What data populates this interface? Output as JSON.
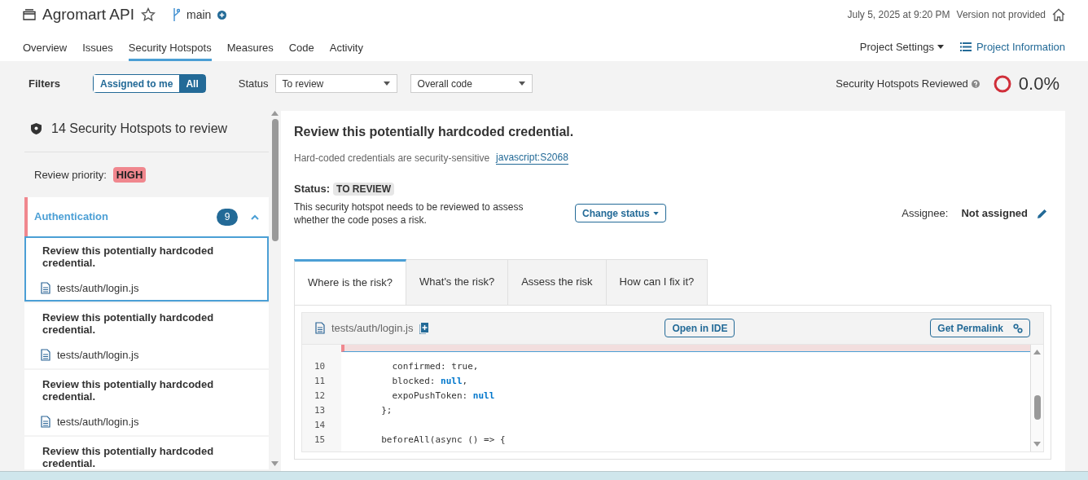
{
  "project": {
    "name": "Agromart API",
    "branch": "main",
    "date": "July 5, 2025 at 9:20 PM",
    "version": "Version not provided"
  },
  "nav": {
    "tabs": [
      {
        "label": "Overview",
        "selected": false
      },
      {
        "label": "Issues",
        "selected": false
      },
      {
        "label": "Security Hotspots",
        "selected": true
      },
      {
        "label": "Measures",
        "selected": false
      },
      {
        "label": "Code",
        "selected": false
      },
      {
        "label": "Activity",
        "selected": false
      }
    ],
    "settings": "Project Settings",
    "info": "Project Information"
  },
  "filters": {
    "label": "Filters",
    "toggle": [
      {
        "label": "Assigned to me",
        "selected": false
      },
      {
        "label": "All",
        "selected": true
      }
    ],
    "status_label": "Status",
    "status": "To review",
    "scope": "Overall code",
    "reviewed_label": "Security Hotspots Reviewed",
    "reviewed": "0.0%"
  },
  "sidebar": {
    "title": "14 Security Hotspots to review",
    "priority_label": "Review priority:",
    "priority": "HIGH",
    "category": {
      "name": "Authentication",
      "count": "9",
      "expanded": true
    },
    "items": [
      {
        "title": "Review this potentially hardcoded credential.",
        "file": "tests/auth/login.js",
        "selected": true
      },
      {
        "title": "Review this potentially hardcoded credential.",
        "file": "tests/auth/login.js",
        "selected": false
      },
      {
        "title": "Review this potentially hardcoded credential.",
        "file": "tests/auth/login.js",
        "selected": false
      },
      {
        "title": "Review this potentially hardcoded credential.",
        "selected": false
      }
    ]
  },
  "detail": {
    "title": "Review this potentially hardcoded credential.",
    "subtitle": "Hard-coded credentials are security-sensitive",
    "rule": "javascript:S2068",
    "status_label": "Status:",
    "status": "TO REVIEW",
    "description": "This security hotspot needs to be reviewed to assess whether the code poses a risk.",
    "change_status": "Change status",
    "assignee_label": "Assignee:",
    "assignee": "Not assigned",
    "tabs": [
      {
        "label": "Where is the risk?",
        "selected": true
      },
      {
        "label": "What's the risk?",
        "selected": false
      },
      {
        "label": "Assess the risk",
        "selected": false
      },
      {
        "label": "How can I fix it?",
        "selected": false
      }
    ],
    "viewer": {
      "file": "tests/auth/login.js",
      "open_ide": "Open in IDE",
      "permalink": "Get Permalink",
      "lines": [
        {
          "number": "10",
          "tokens": [
            {
              "text": "    confirmed: true,",
              "kind": "plain"
            }
          ]
        },
        {
          "number": "11",
          "tokens": [
            {
              "text": "    blocked: ",
              "kind": "plain"
            },
            {
              "text": "null",
              "kind": "keyword"
            },
            {
              "text": ",",
              "kind": "plain"
            }
          ]
        },
        {
          "number": "12",
          "tokens": [
            {
              "text": "    expoPushToken: ",
              "kind": "plain"
            },
            {
              "text": "null",
              "kind": "keyword"
            }
          ]
        },
        {
          "number": "13",
          "tokens": [
            {
              "text": "  };",
              "kind": "plain"
            }
          ]
        },
        {
          "number": "14"
        },
        {
          "number": "15",
          "tokens": [
            {
              "text": "  beforeAll(async () => {",
              "kind": "plain"
            }
          ]
        }
      ]
    }
  }
}
